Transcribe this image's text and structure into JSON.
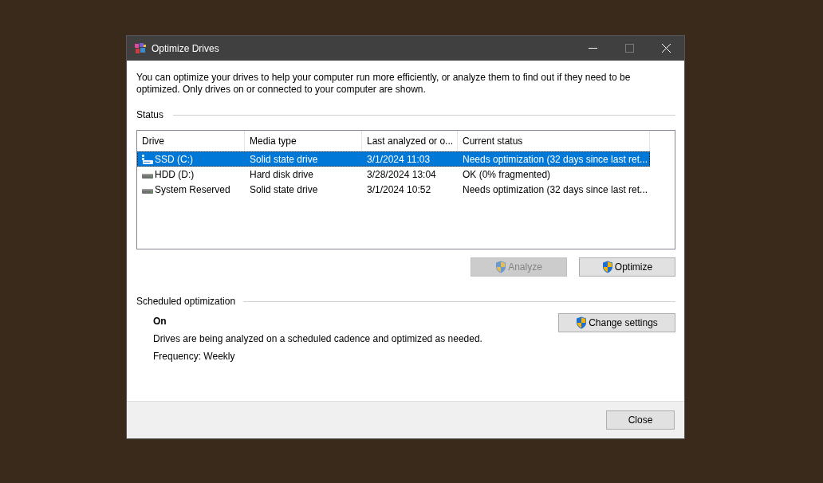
{
  "window": {
    "title": "Optimize Drives",
    "controls": [
      {
        "kind": "minimize",
        "disabled": false
      },
      {
        "kind": "maximize",
        "disabled": true
      },
      {
        "kind": "close",
        "disabled": false
      }
    ]
  },
  "intro": "You can optimize your drives to help your computer run more efficiently, or analyze them to find out if they need to be optimized. Only drives on or connected to your computer are shown.",
  "status_section": {
    "heading": "Status"
  },
  "table": {
    "columns": [
      "Drive",
      "Media type",
      "Last analyzed or o...",
      "Current status"
    ],
    "rows": [
      {
        "drive": "SSD (C:)",
        "media_type": "Solid state drive",
        "last_analyzed": "3/1/2024 11:03",
        "current_status": "Needs optimization (32 days since last ret...",
        "selected": true
      },
      {
        "drive": "HDD (D:)",
        "media_type": "Hard disk drive",
        "last_analyzed": "3/28/2024 13:04",
        "current_status": "OK (0% fragmented)",
        "selected": false
      },
      {
        "drive": "System Reserved",
        "media_type": "Solid state drive",
        "last_analyzed": "3/1/2024 10:52",
        "current_status": "Needs optimization (32 days since last ret...",
        "selected": false
      }
    ]
  },
  "actions": [
    {
      "label": "Analyze",
      "disabled": true
    },
    {
      "label": "Optimize",
      "disabled": false
    }
  ],
  "scheduled": {
    "heading": "Scheduled optimization",
    "state": "On",
    "description": "Drives are being analyzed on a scheduled cadence and optimized as needed.",
    "frequency": "Frequency: Weekly",
    "button": "Change settings"
  },
  "footer": {
    "close": "Close"
  }
}
